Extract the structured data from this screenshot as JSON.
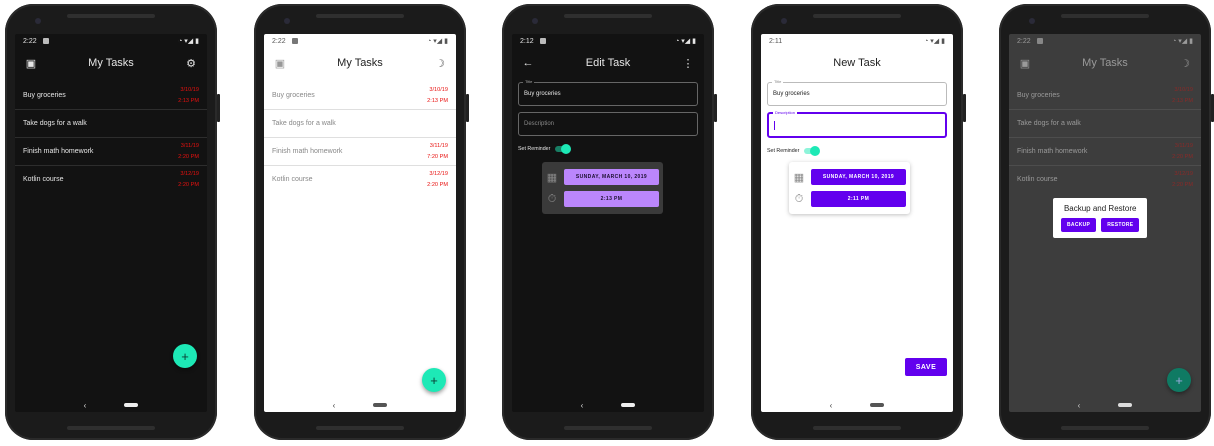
{
  "colors": {
    "accent": "#1de9b6",
    "purple": "#6200ee",
    "light_purple": "#bb86fc",
    "due_red": "#e8110f"
  },
  "phones": [
    {
      "theme": "dark",
      "status_time": "2:22",
      "title": "My Tasks",
      "left_icon": "backup-icon",
      "right_icon": "gear-icon",
      "tasks": [
        {
          "name": "Buy groceries",
          "date": "3/10/19",
          "time": "2:13 PM"
        },
        {
          "name": "Take dogs for a walk",
          "date": "",
          "time": ""
        },
        {
          "name": "Finish math homework",
          "date": "3/11/19",
          "time": "2:20 PM"
        },
        {
          "name": "Kotlin course",
          "date": "3/12/19",
          "time": "2:20 PM"
        }
      ]
    },
    {
      "theme": "light",
      "status_time": "2:22",
      "title": "My Tasks",
      "left_icon": "backup-icon",
      "right_icon": "moon-icon",
      "tasks": [
        {
          "name": "Buy groceries",
          "date": "3/10/19",
          "time": "2:13 PM"
        },
        {
          "name": "Take dogs for a walk",
          "date": "",
          "time": ""
        },
        {
          "name": "Finish math homework",
          "date": "3/11/19",
          "time": "7:20 PM"
        },
        {
          "name": "Kotlin course",
          "date": "3/12/19",
          "time": "2:20 PM"
        }
      ]
    },
    {
      "theme": "dark",
      "status_time": "2:12",
      "title": "Edit Task",
      "title_label": "Title",
      "title_value": "Buy groceries",
      "description_placeholder": "Description",
      "reminder_label": "Set Reminder",
      "date_button": "SUNDAY, MARCH 10, 2019",
      "time_button": "2:13 PM"
    },
    {
      "theme": "light",
      "status_time": "2:11",
      "title": "New Task",
      "title_label": "Title",
      "title_value": "Buy groceries",
      "description_label": "Description",
      "reminder_label": "Set Reminder",
      "date_button": "SUNDAY, MARCH 10, 2019",
      "time_button": "2:11 PM",
      "save_button": "SAVE"
    },
    {
      "theme": "dark",
      "status_time": "2:22",
      "title": "My Tasks",
      "tasks": [
        {
          "name": "Buy groceries",
          "date": "3/10/19",
          "time": "2:13 PM"
        },
        {
          "name": "Take dogs for a walk",
          "date": "",
          "time": ""
        },
        {
          "name": "Finish math homework",
          "date": "3/11/19",
          "time": "2:20 PM"
        },
        {
          "name": "Kotlin course",
          "date": "3/12/19",
          "time": "2:20 PM"
        }
      ],
      "dialog": {
        "title": "Backup and Restore",
        "backup": "BACKUP",
        "restore": "RESTORE"
      }
    }
  ]
}
